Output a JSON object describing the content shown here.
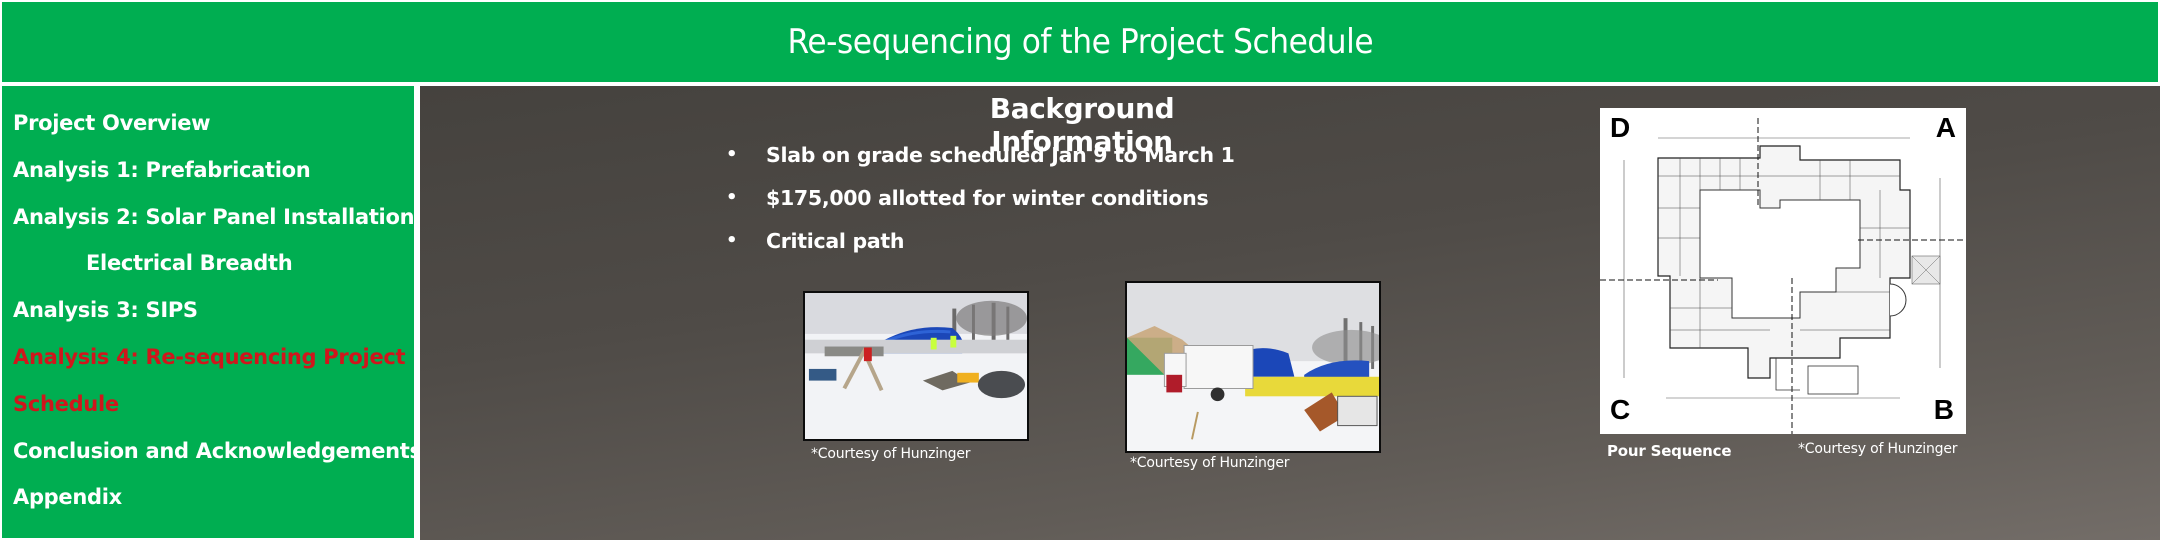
{
  "header": {
    "title": "Re-sequencing of the Project Schedule"
  },
  "sidebar": {
    "items": [
      {
        "label": "Project Overview",
        "active": false,
        "sub": false
      },
      {
        "label": "Analysis 1: Prefabrication",
        "active": false,
        "sub": false
      },
      {
        "label": "Analysis 2: Solar Panel Installation",
        "active": false,
        "sub": false
      },
      {
        "label": "Electrical Breadth",
        "active": false,
        "sub": true
      },
      {
        "label": "Analysis 3: SIPS",
        "active": false,
        "sub": false
      },
      {
        "label": "Analysis 4: Re-sequencing Project",
        "active": true,
        "sub": false
      },
      {
        "label": "Schedule",
        "active": true,
        "sub": false
      },
      {
        "label": "Conclusion and Acknowledgements",
        "active": false,
        "sub": false
      },
      {
        "label": "Appendix",
        "active": false,
        "sub": false
      }
    ]
  },
  "main": {
    "section_title": "Background Information",
    "bullets": [
      "Slab on grade scheduled Jan 9 to March 1",
      "$175,000 allotted for winter conditions",
      "Critical path"
    ],
    "bullet_glyph": "•",
    "photos": [
      {
        "name": "site-photo-1",
        "caption": "*Courtesy of Hunzinger"
      },
      {
        "name": "site-photo-2",
        "caption": "*Courtesy of Hunzinger"
      }
    ],
    "plan": {
      "corners": {
        "top_left": "D",
        "top_right": "A",
        "bottom_left": "C",
        "bottom_right": "B"
      },
      "caption_left": "Pour Sequence",
      "caption_right": "*Courtesy of Hunzinger"
    }
  },
  "colors": {
    "brand_green": "#00ae51",
    "active_red": "#d0161c",
    "panel_dark": "#45423e",
    "panel_light": "#736d68",
    "tarp_blue": "#1b47b8"
  }
}
